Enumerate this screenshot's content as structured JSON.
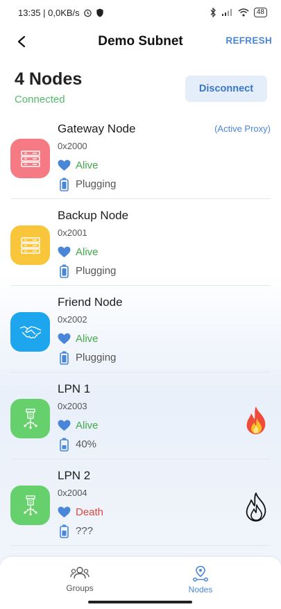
{
  "status_bar": {
    "time_speed": "13:35 | 0,0KB/s",
    "battery": "48"
  },
  "app_bar": {
    "title": "Demo Subnet",
    "refresh_label": "REFRESH"
  },
  "summary": {
    "node_count": "4 Nodes",
    "connection_status": "Connected",
    "disconnect_label": "Disconnect"
  },
  "nodes": [
    {
      "name": "Gateway Node",
      "address": "0x2000",
      "status": "Alive",
      "power": "Plugging",
      "tag": "(Active Proxy)",
      "icon": "server-icon",
      "color": "#f57a83"
    },
    {
      "name": "Backup Node",
      "address": "0x2001",
      "status": "Alive",
      "power": "Plugging",
      "icon": "server-icon",
      "color": "#f9c53a"
    },
    {
      "name": "Friend Node",
      "address": "0x2002",
      "status": "Alive",
      "power": "Plugging",
      "icon": "handshake-icon",
      "color": "#1da5ee"
    },
    {
      "name": "LPN 1",
      "address": "0x2003",
      "status": "Alive",
      "power": "40%",
      "icon": "sensor-icon",
      "color": "#66d06c",
      "flame": "active"
    },
    {
      "name": "LPN 2",
      "address": "0x2004",
      "status": "Death",
      "power": "???",
      "icon": "sensor-icon",
      "color": "#66d06c",
      "flame": "outline"
    }
  ],
  "bottom_nav": {
    "groups_label": "Groups",
    "nodes_label": "Nodes",
    "active": "nodes"
  },
  "colors": {
    "accent": "#4a86d8",
    "alive": "#43a84a",
    "death": "#e0463d",
    "connected": "#53b96a"
  }
}
